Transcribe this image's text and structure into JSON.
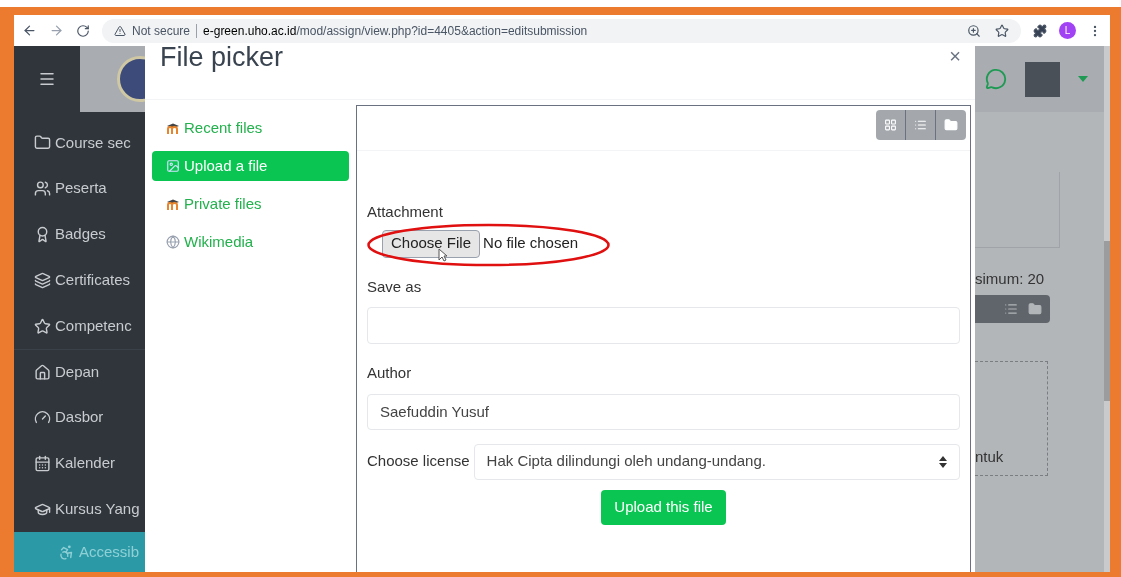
{
  "browser": {
    "security": "Not secure",
    "url_host": "e-green.uho.ac.id",
    "url_path": "/mod/assign/view.php?id=4405&action=editsubmission",
    "profile_initial": "L"
  },
  "sidebar": {
    "items": [
      {
        "label": "Course sec",
        "kind": "folder"
      },
      {
        "label": "Peserta",
        "kind": "people"
      },
      {
        "label": "Badges",
        "kind": "badge"
      },
      {
        "label": "Certificates",
        "kind": "layers"
      },
      {
        "label": "Competenc",
        "kind": "star"
      },
      {
        "label": "Depan",
        "kind": "home"
      },
      {
        "label": "Dasbor",
        "kind": "gauge"
      },
      {
        "label": "Kalender",
        "kind": "calendar"
      },
      {
        "label": "Kursus Yang",
        "kind": "cap"
      }
    ],
    "accessibility": "Accessib"
  },
  "modal": {
    "title": "File picker",
    "close": "×",
    "repositories": [
      {
        "label": "Recent files",
        "kind": "moodle",
        "selected": false
      },
      {
        "label": "Upload a file",
        "kind": "upload",
        "selected": true
      },
      {
        "label": "Private files",
        "kind": "moodle",
        "selected": false
      },
      {
        "label": "Wikimedia",
        "kind": "wikimedia",
        "selected": false
      }
    ],
    "form": {
      "attachment_label": "Attachment",
      "choose_file": "Choose File",
      "no_file": "No file chosen",
      "save_as_label": "Save as",
      "author_label": "Author",
      "author_value": "Saefuddin Yusuf",
      "license_label": "Choose license",
      "license_value": "Hak Cipta dilindungi oleh undang-undang.",
      "upload_button": "Upload this file"
    }
  },
  "background_page": {
    "max_text": "simum: 20",
    "dropzone_text": "ntuk"
  }
}
